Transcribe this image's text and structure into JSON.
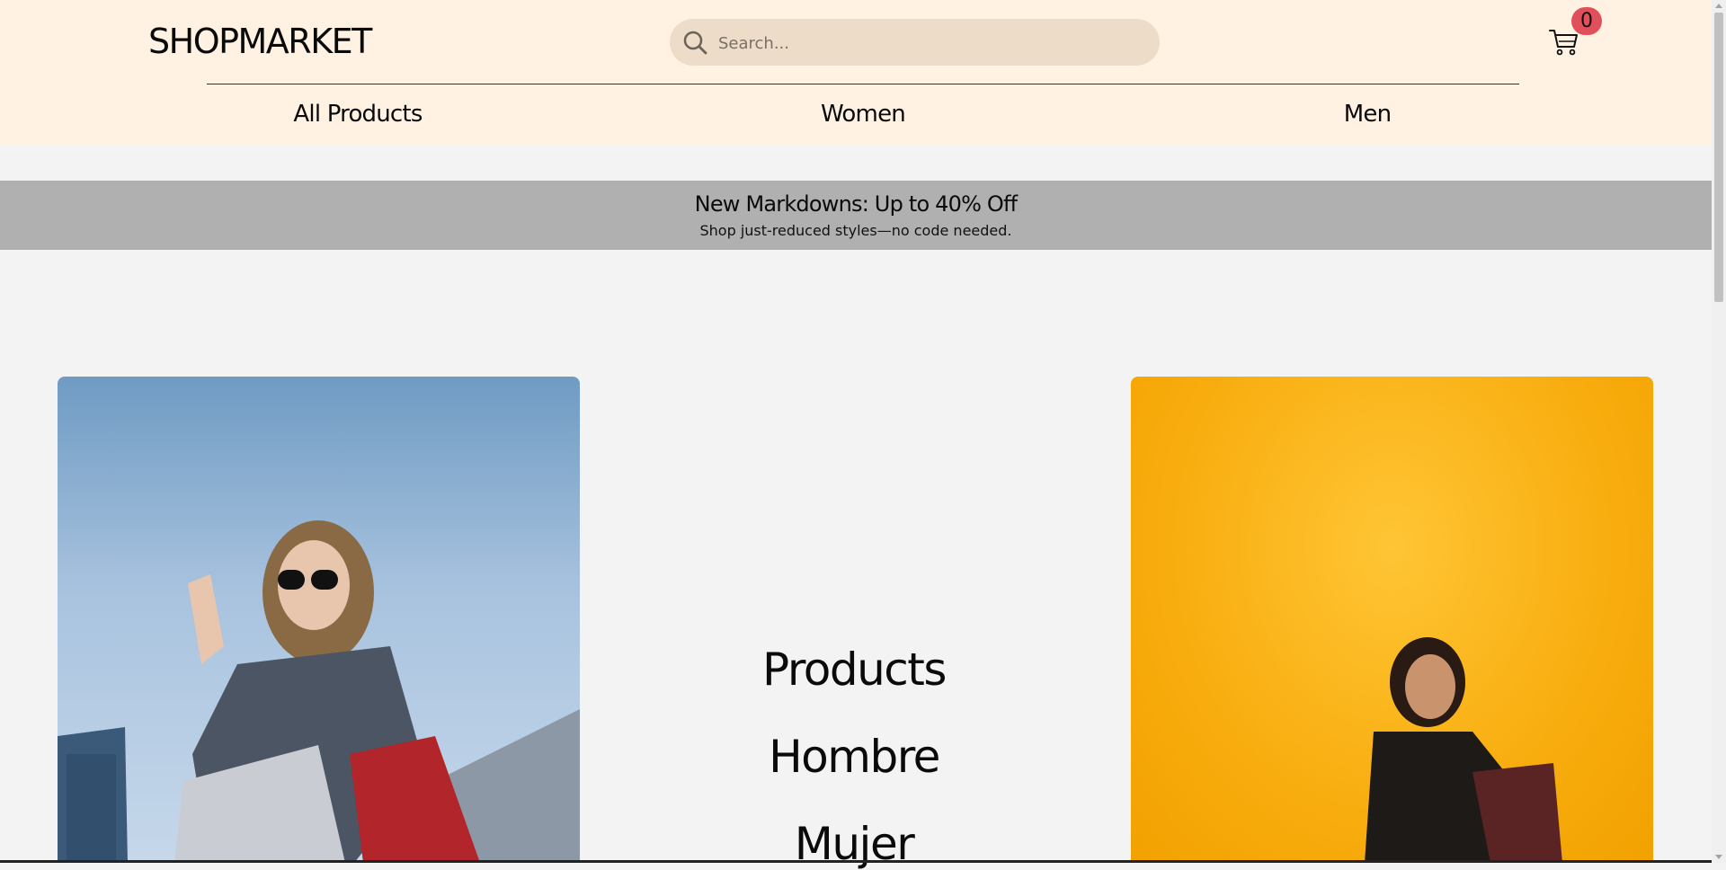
{
  "header": {
    "logo": "SHOPMARKET",
    "search": {
      "placeholder": "Search...",
      "value": ""
    },
    "cart": {
      "count": "0"
    },
    "nav": [
      {
        "label": "All Products"
      },
      {
        "label": "Women"
      },
      {
        "label": "Men"
      }
    ]
  },
  "promo": {
    "title": "New Markdowns: Up to 40% Off",
    "subtitle": "Shop just-reduced styles—no code needed."
  },
  "hero": {
    "links": [
      {
        "label": "Products"
      },
      {
        "label": "Hombre"
      },
      {
        "label": "Mujer"
      }
    ]
  },
  "colors": {
    "header_bg": "#fff2e2",
    "search_bg": "#ecdcc8",
    "badge": "#e0505a",
    "promo_bg": "#b0b0b0",
    "page_bg": "#f3f3f3"
  },
  "icons": {
    "search": "search-icon",
    "cart": "cart-icon"
  }
}
